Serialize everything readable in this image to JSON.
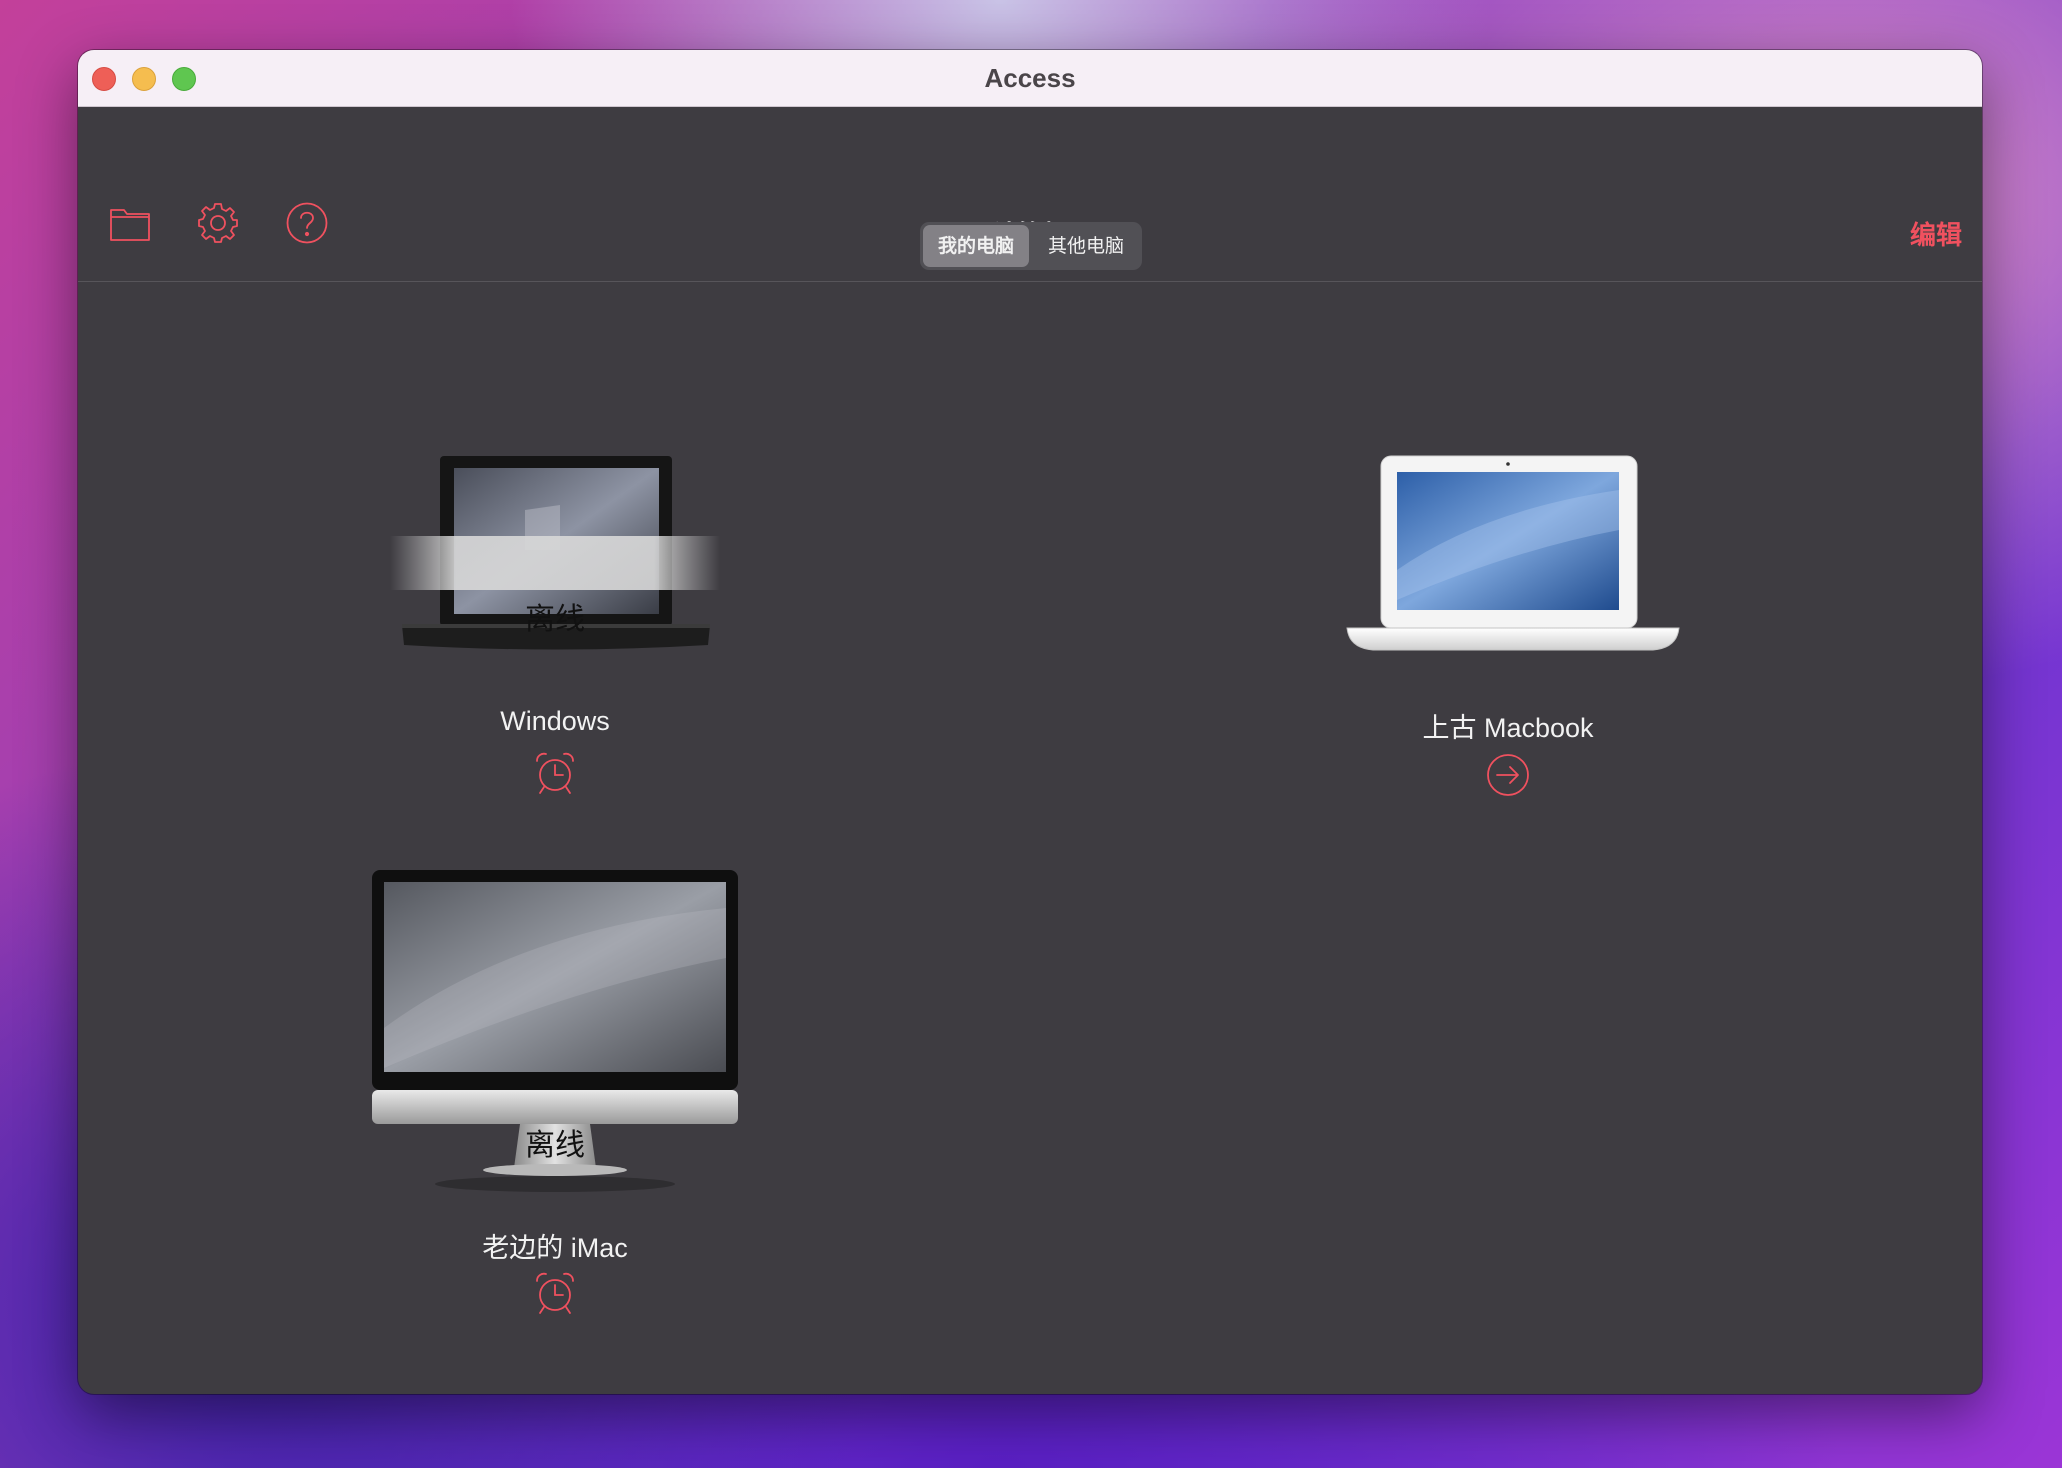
{
  "window": {
    "title": "Access"
  },
  "toolbar": {
    "folder_icon": "folder-icon",
    "settings_icon": "gear-icon",
    "help_icon": "question-circle-icon",
    "title": "计算机",
    "edit_label": "编辑",
    "add_icon": "plus-icon"
  },
  "segment": {
    "mine": "我的电脑",
    "other": "其他电脑",
    "selected": "我的电脑"
  },
  "devices": [
    {
      "name": "Windows",
      "status": "离线",
      "status_icon": "alarm-clock-icon"
    },
    {
      "name": "上古 Macbook",
      "status_icon": "arrow-right-circle-icon"
    },
    {
      "name": "老边的 iMac",
      "status": "离线",
      "status_icon": "alarm-clock-icon"
    }
  ],
  "colors": {
    "accent": "#f0515f",
    "content_bg": "#3e3c41",
    "titlebar_bg": "#f6eff6"
  }
}
